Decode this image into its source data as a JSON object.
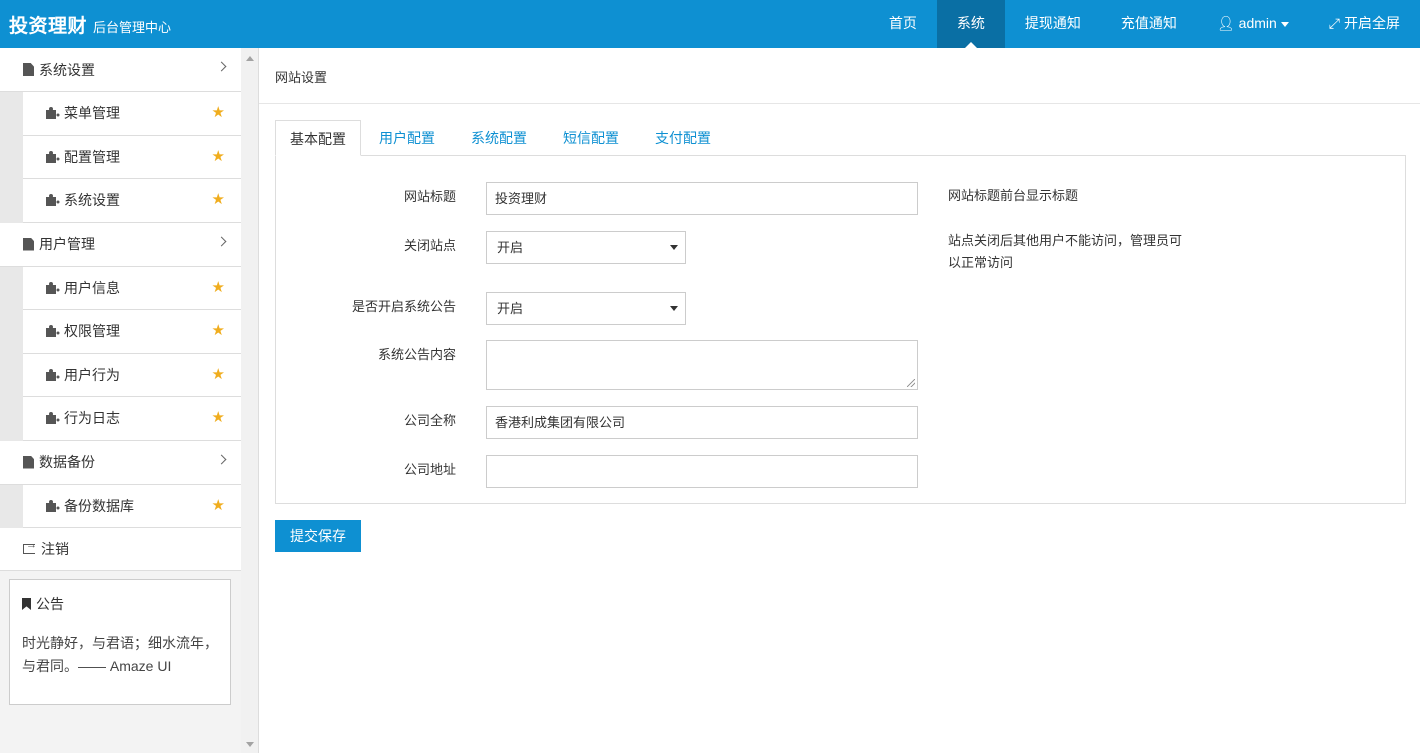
{
  "header": {
    "brand_title": "投资理财",
    "brand_subtitle": "后台管理中心",
    "nav": [
      {
        "label": "首页"
      },
      {
        "label": "系统"
      },
      {
        "label": "提现通知"
      },
      {
        "label": "充值通知"
      },
      {
        "label": "admin"
      },
      {
        "label": "开启全屏"
      }
    ],
    "active_nav": "系统",
    "user_icon": "user-icon",
    "fullscreen_icon": "expand-icon",
    "bar_color": "#0e90d2"
  },
  "sidebar": {
    "groups": [
      {
        "label": "系统设置",
        "icon": "file-icon",
        "children": [
          {
            "label": "菜单管理",
            "icon": "puzzle-icon"
          },
          {
            "label": "配置管理",
            "icon": "puzzle-icon"
          },
          {
            "label": "系统设置",
            "icon": "puzzle-icon"
          }
        ]
      },
      {
        "label": "用户管理",
        "icon": "file-icon",
        "children": [
          {
            "label": "用户信息",
            "icon": "puzzle-icon"
          },
          {
            "label": "权限管理",
            "icon": "puzzle-icon"
          },
          {
            "label": "用户行为",
            "icon": "puzzle-icon"
          },
          {
            "label": "行为日志",
            "icon": "puzzle-icon"
          }
        ]
      },
      {
        "label": "数据备份",
        "icon": "file-icon",
        "children": [
          {
            "label": "备份数据库",
            "icon": "puzzle-icon"
          }
        ]
      }
    ],
    "logout_label": "注销",
    "star_color": "#f0ad1e",
    "notice": {
      "title": "公告",
      "text": "时光静好，与君语；细水流年，与君同。—— Amaze UI"
    }
  },
  "main": {
    "breadcrumb": "网站设置",
    "tabs": [
      {
        "label": "基本配置"
      },
      {
        "label": "用户配置"
      },
      {
        "label": "系统配置"
      },
      {
        "label": "短信配置"
      },
      {
        "label": "支付配置"
      }
    ],
    "active_tab": "基本配置",
    "form": {
      "site_title": {
        "label": "网站标题",
        "value": "投资理财",
        "help": "网站标题前台显示标题"
      },
      "close_site": {
        "label": "关闭站点",
        "value": "开启",
        "help": "站点关闭后其他用户不能访问，管理员可以正常访问"
      },
      "announce_enabled": {
        "label": "是否开启系统公告",
        "value": "开启"
      },
      "announce_content": {
        "label": "系统公告内容",
        "value": ""
      },
      "company_name": {
        "label": "公司全称",
        "value": "香港利成集团有限公司"
      },
      "company_address": {
        "label": "公司地址",
        "value": ""
      }
    },
    "submit_label": "提交保存"
  }
}
